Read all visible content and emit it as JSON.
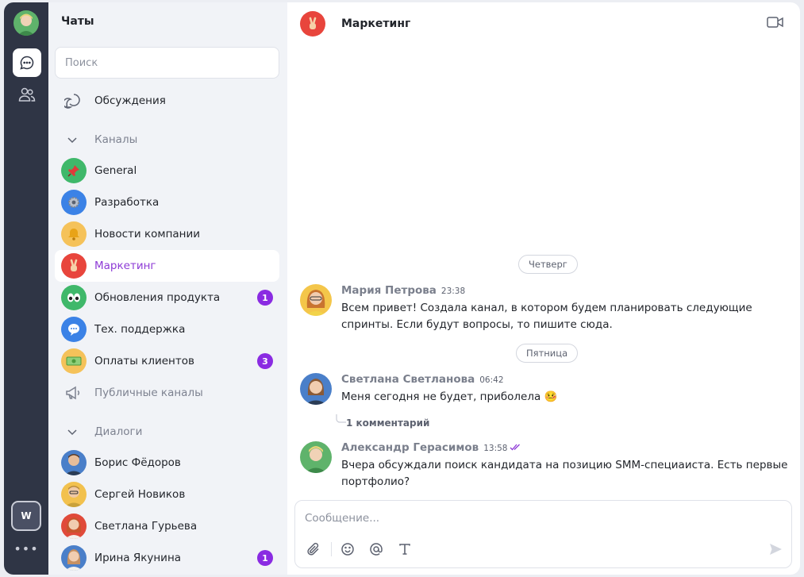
{
  "sidebar": {
    "title": "Чаты",
    "search_placeholder": "Поиск",
    "discussions": "Обсуждения",
    "channels_section": "Каналы",
    "channels": [
      {
        "label": "General",
        "badge": "",
        "icon": "pin-icon",
        "color": "#3fb86a"
      },
      {
        "label": "Разработка",
        "badge": "",
        "icon": "gear-icon",
        "color": "#3b82e6"
      },
      {
        "label": "Новости компании",
        "badge": "",
        "icon": "bell-icon",
        "color": "#f5c25a"
      },
      {
        "label": "Маркетинг",
        "badge": "",
        "icon": "victory-hand-icon",
        "color": "#e8453c"
      },
      {
        "label": "Обновления продукта",
        "badge": "1",
        "icon": "eyes-icon",
        "color": "#3fb86a"
      },
      {
        "label": "Тех. поддержка",
        "badge": "",
        "icon": "speech-bubble-icon",
        "color": "#3b82e6"
      },
      {
        "label": "Оплаты клиентов",
        "badge": "3",
        "icon": "money-icon",
        "color": "#f5c25a"
      }
    ],
    "public_channels": "Публичные каналы",
    "dialogs_section": "Диалоги",
    "dialogs": [
      {
        "label": "Борис Фёдоров",
        "badge": "",
        "color": "#4a7fc9"
      },
      {
        "label": "Сергей Новиков",
        "badge": "",
        "color": "#f2c14e"
      },
      {
        "label": "Светлана Гурьева",
        "badge": "",
        "color": "#e04a3a"
      },
      {
        "label": "Ирина Якунина",
        "badge": "1",
        "color": "#4a7fc9"
      }
    ]
  },
  "rail": {
    "workspace": "W",
    "more": "•••"
  },
  "chat": {
    "title": "Маркетинг",
    "day1": "Четверг",
    "day2": "Пятница",
    "messages": [
      {
        "author": "Мария Петрова",
        "time": "23:38",
        "text": "Всем привет! Создала канал, в котором будем планировать следующие спринты. Если будут вопросы, то пишите сюда."
      },
      {
        "author": "Светлана Светланова",
        "time": "06:42",
        "text": "Меня сегодня не будет, приболела 🤒",
        "reply": "1 комментарий"
      },
      {
        "author": "Александр Герасимов",
        "time": "13:58",
        "text": "Вчера обсуждали поиск кандидата на позицию SMM-специаиста. Есть первые портфолио?"
      }
    ],
    "composer_placeholder": "Сообщение..."
  },
  "colors": {
    "accent": "#8a2be2",
    "rail": "#2f3545",
    "active_text": "#8e3bd6"
  }
}
